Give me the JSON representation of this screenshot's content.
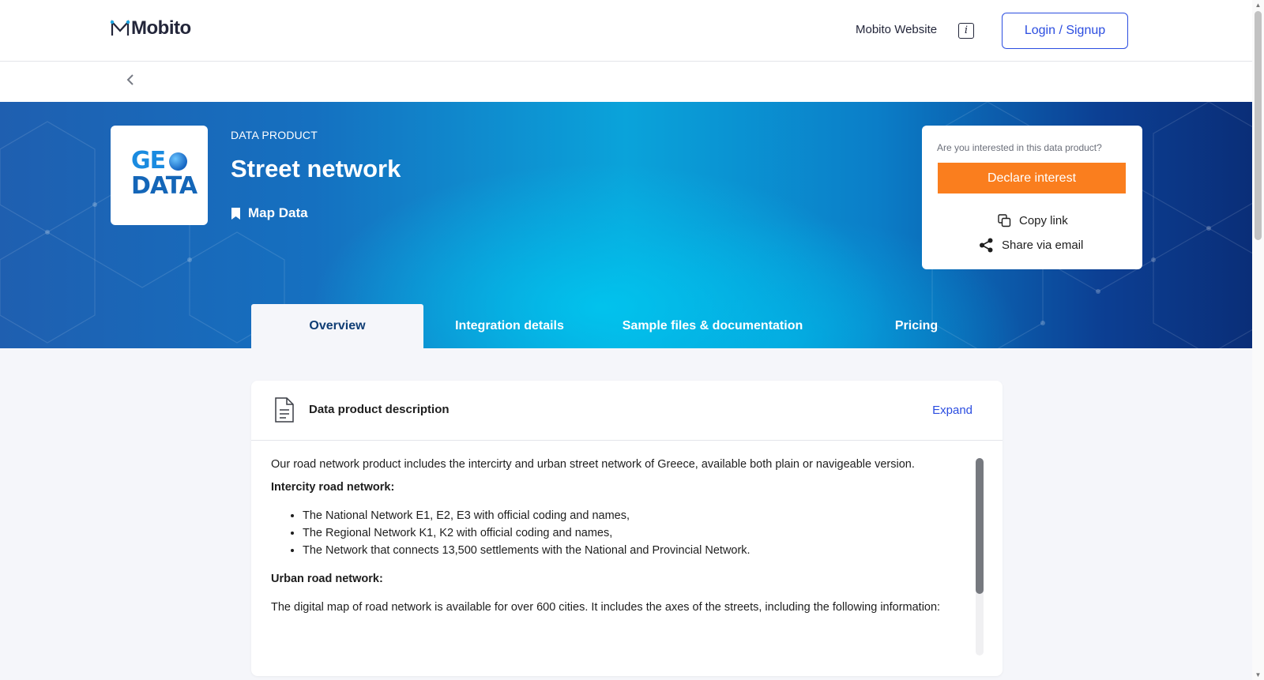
{
  "header": {
    "logo": "Mobito",
    "website_link": "Mobito Website",
    "login_label": "Login / Signup"
  },
  "hero": {
    "logo_line1": "GE",
    "logo_line2": "DATA",
    "kicker": "DATA PRODUCT",
    "title": "Street network",
    "category": "Map Data"
  },
  "interest": {
    "question": "Are you interested in this data product?",
    "declare_label": "Declare interest",
    "copy_label": "Copy link",
    "share_label": "Share via email"
  },
  "tabs": [
    {
      "label": "Overview",
      "active": true
    },
    {
      "label": "Integration details",
      "active": false
    },
    {
      "label": "Sample files & documentation",
      "active": false
    },
    {
      "label": "Pricing",
      "active": false
    }
  ],
  "description": {
    "title": "Data product description",
    "expand_label": "Expand",
    "intro": "Our road network product includes the intercirty and urban street network of Greece, available both plain or navigeable version.",
    "intercity_heading": "Intercity road network:",
    "intercity_items": [
      "The National Network E1, E2, E3 with official coding and names,",
      "The Regional Network K1, K2 with official coding and names,",
      "The Network that connects 13,500 settlements with the National and Provincial Network."
    ],
    "urban_heading": "Urban road network:",
    "urban_text": "The digital map of road network is available for over 600 cities. It includes the axes of the streets, including the following information:"
  },
  "colors": {
    "accent_blue": "#2b4de0",
    "declare_orange": "#fa7e1e",
    "tab_active_text": "#0f3d74"
  },
  "icons": {
    "back": "chevron-left-icon",
    "info": "info-icon",
    "category": "bookmark-icon",
    "copy": "copy-icon",
    "share": "share-icon",
    "description": "document-icon"
  }
}
